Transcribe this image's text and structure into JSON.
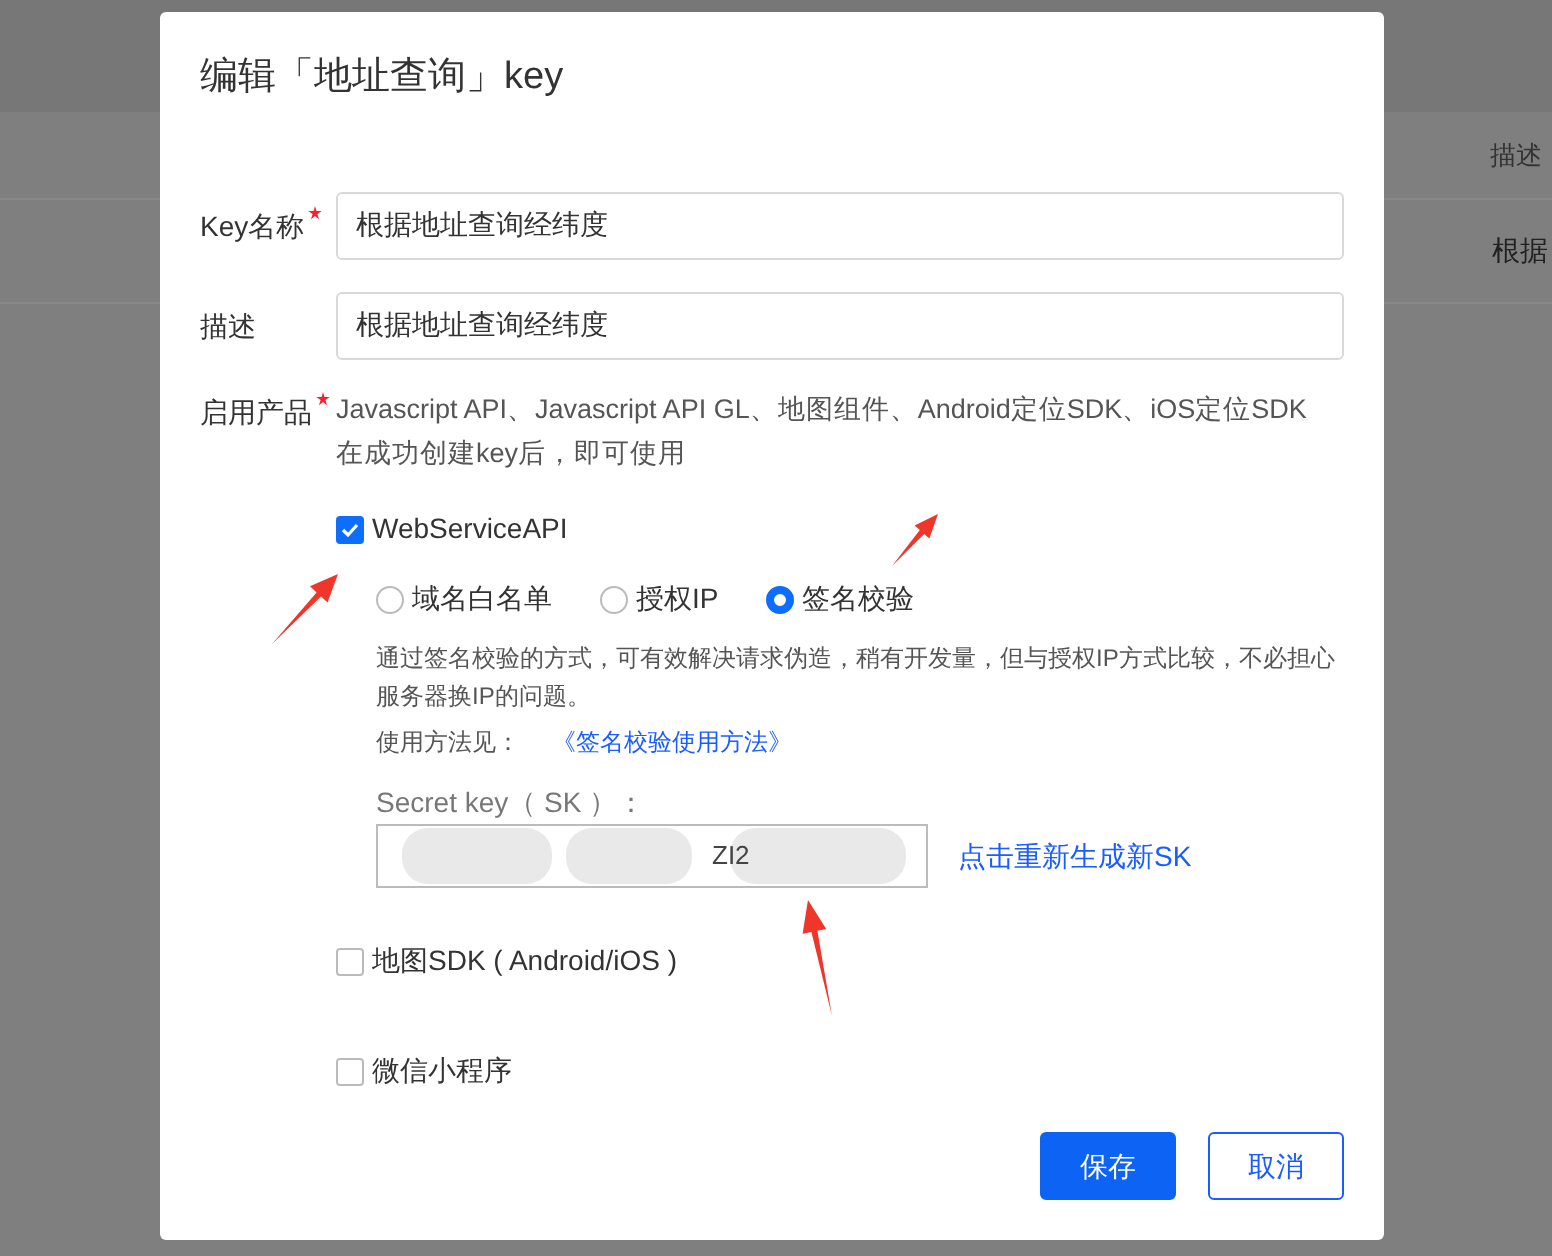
{
  "background": {
    "column_header": "描述",
    "row_cell": "根据"
  },
  "dialog": {
    "title": "编辑「地址查询」key",
    "fields": [
      {
        "label": "Key名称",
        "required": true,
        "value": "根据地址查询经纬度"
      },
      {
        "label": "描述",
        "required": false,
        "value": "根据地址查询经纬度"
      }
    ],
    "products": {
      "label": "启用产品",
      "required": true,
      "summary": [
        "Javascript API、Javascript API GL、地图组件、Android定位SDK、iOS定位SDK",
        "在成功创建key后，即可使用"
      ],
      "options": [
        {
          "label": "WebServiceAPI",
          "checked": true,
          "expanded": true,
          "modes": [
            {
              "label": "域名白名单",
              "selected": false
            },
            {
              "label": "授权IP",
              "selected": false
            },
            {
              "label": "签名校验",
              "selected": true
            }
          ],
          "note": [
            "通过签名校验的方式，可有效解决请求伪造，稍有开发量，但与授权IP方式比较，不必担心",
            "服务器换IP的问题。"
          ],
          "usage_label": "使用方法见：",
          "usage_link": "《签名校验使用方法》",
          "sk_label": "Secret key（ SK ）：",
          "sk_value": "ZI2",
          "regenerate_link": "点击重新生成新SK"
        },
        {
          "label": "地图SDK ( Android/iOS )",
          "checked": false,
          "expanded": false
        },
        {
          "label": "微信小程序",
          "checked": false,
          "expanded": false
        }
      ]
    },
    "buttons": [
      {
        "label": "保存",
        "kind": "primary"
      },
      {
        "label": "取消",
        "kind": "outline"
      }
    ]
  }
}
